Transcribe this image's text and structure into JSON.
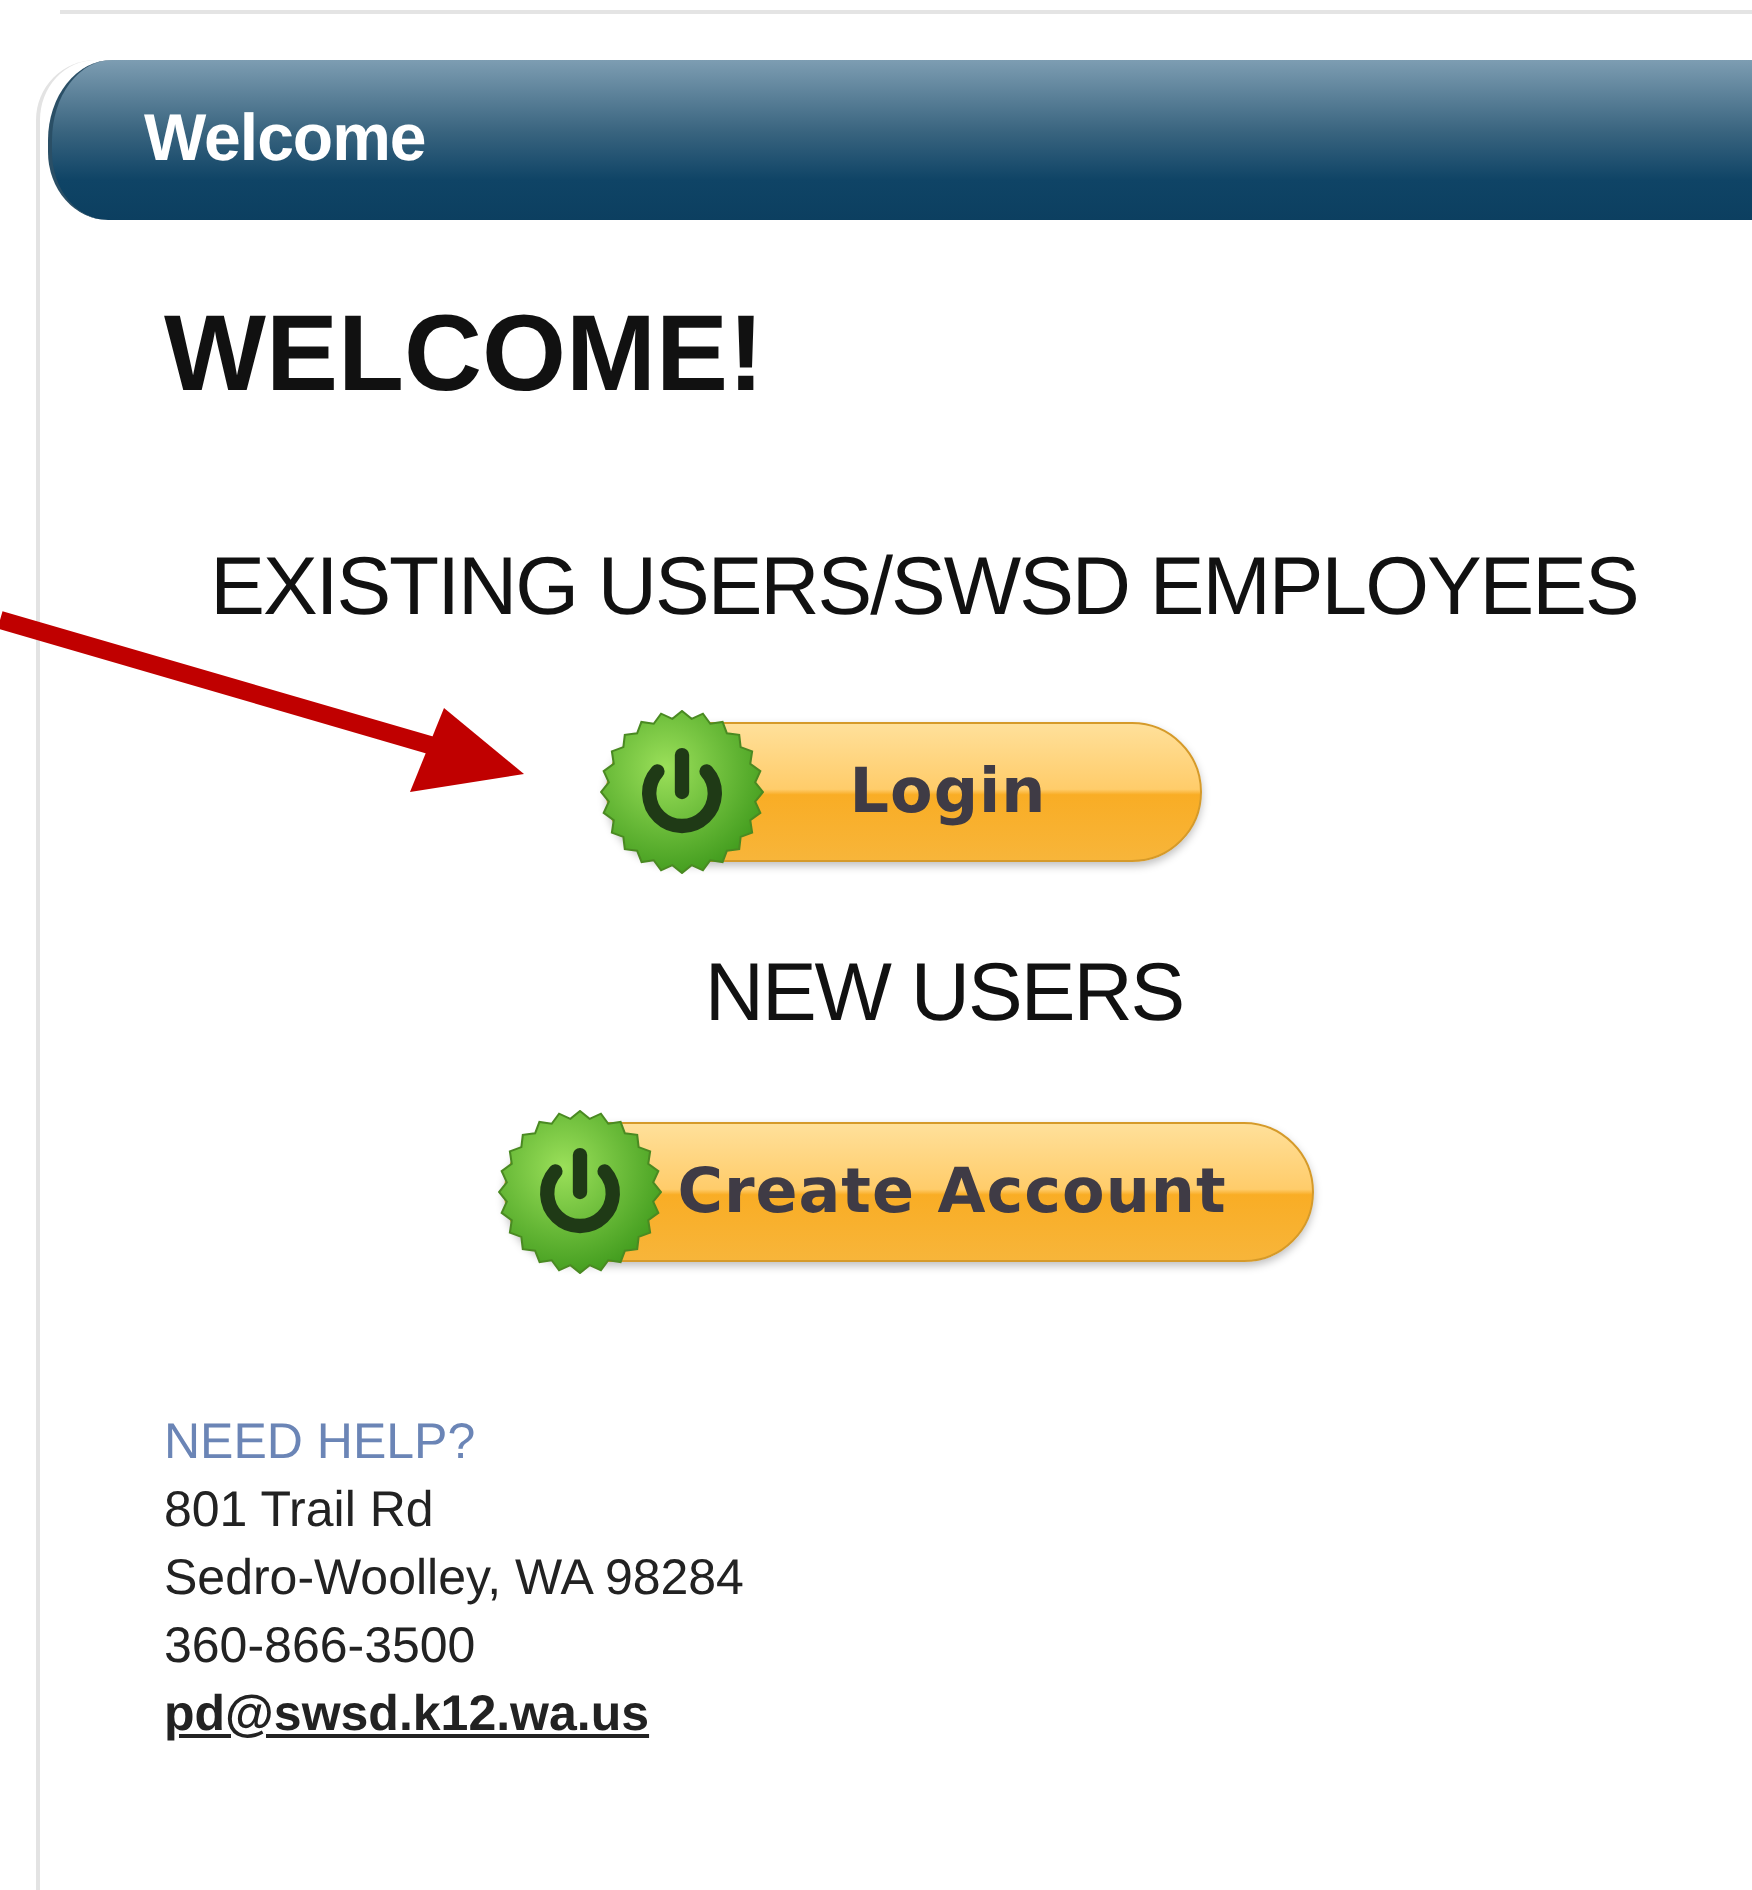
{
  "panel": {
    "title": "Welcome"
  },
  "heading": "WELCOME!",
  "sections": [
    {
      "label": "EXISTING USERS/SWSD EMPLOYEES",
      "button": "Login"
    },
    {
      "label": "NEW USERS",
      "button": "Create Account"
    }
  ],
  "help": {
    "title": "NEED HELP?",
    "lines": [
      "801 Trail Rd",
      "Sedro-Woolley, WA 98284",
      "360-866-3500"
    ],
    "email": "pd@swsd.k12.wa.us"
  }
}
